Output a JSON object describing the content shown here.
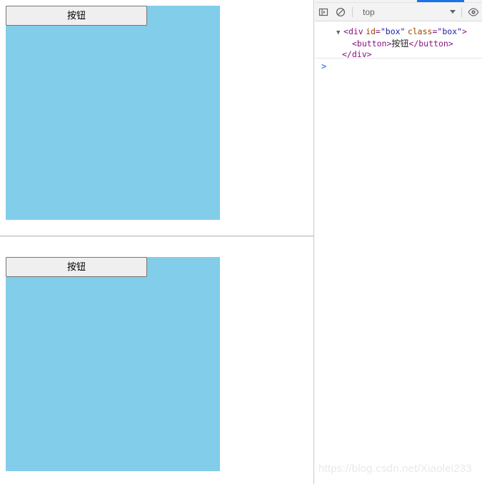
{
  "page": {
    "blocks": [
      {
        "button_label": "按钮",
        "box_color": "#82cdea"
      },
      {
        "button_label": "按钮",
        "box_color": "#82cdea"
      }
    ],
    "divider": "horizontal-rule"
  },
  "devtools": {
    "tab_indicator_color": "#1a73e8",
    "toolbar": {
      "sidebar_toggle_icon": "sidebar-toggle-icon",
      "clear_console_icon": "clear-console-icon",
      "context_selector_value": "top",
      "context_selector_caret": "chevron-down-icon",
      "eye_icon": "eye-icon"
    },
    "console": {
      "message": {
        "disclosure_triangle": "▼",
        "line1": {
          "open_bracket": "<",
          "tag": "div",
          "attr1_name": "id",
          "attr1_eq": "=",
          "attr1_value": "\"box\"",
          "attr2_name": "class",
          "attr2_eq": "=",
          "attr2_value": "\"box\"",
          "close_bracket": ">"
        },
        "line2": {
          "open_tag": "<button>",
          "text": "按钮",
          "close_tag": "</button>"
        },
        "line3": {
          "close_tag": "</div>"
        }
      },
      "prompt_chevron": ">",
      "prompt_value": "",
      "prompt_placeholder": ""
    }
  },
  "watermark": {
    "text": "https://blog.csdn.net/Xiaolei233"
  }
}
